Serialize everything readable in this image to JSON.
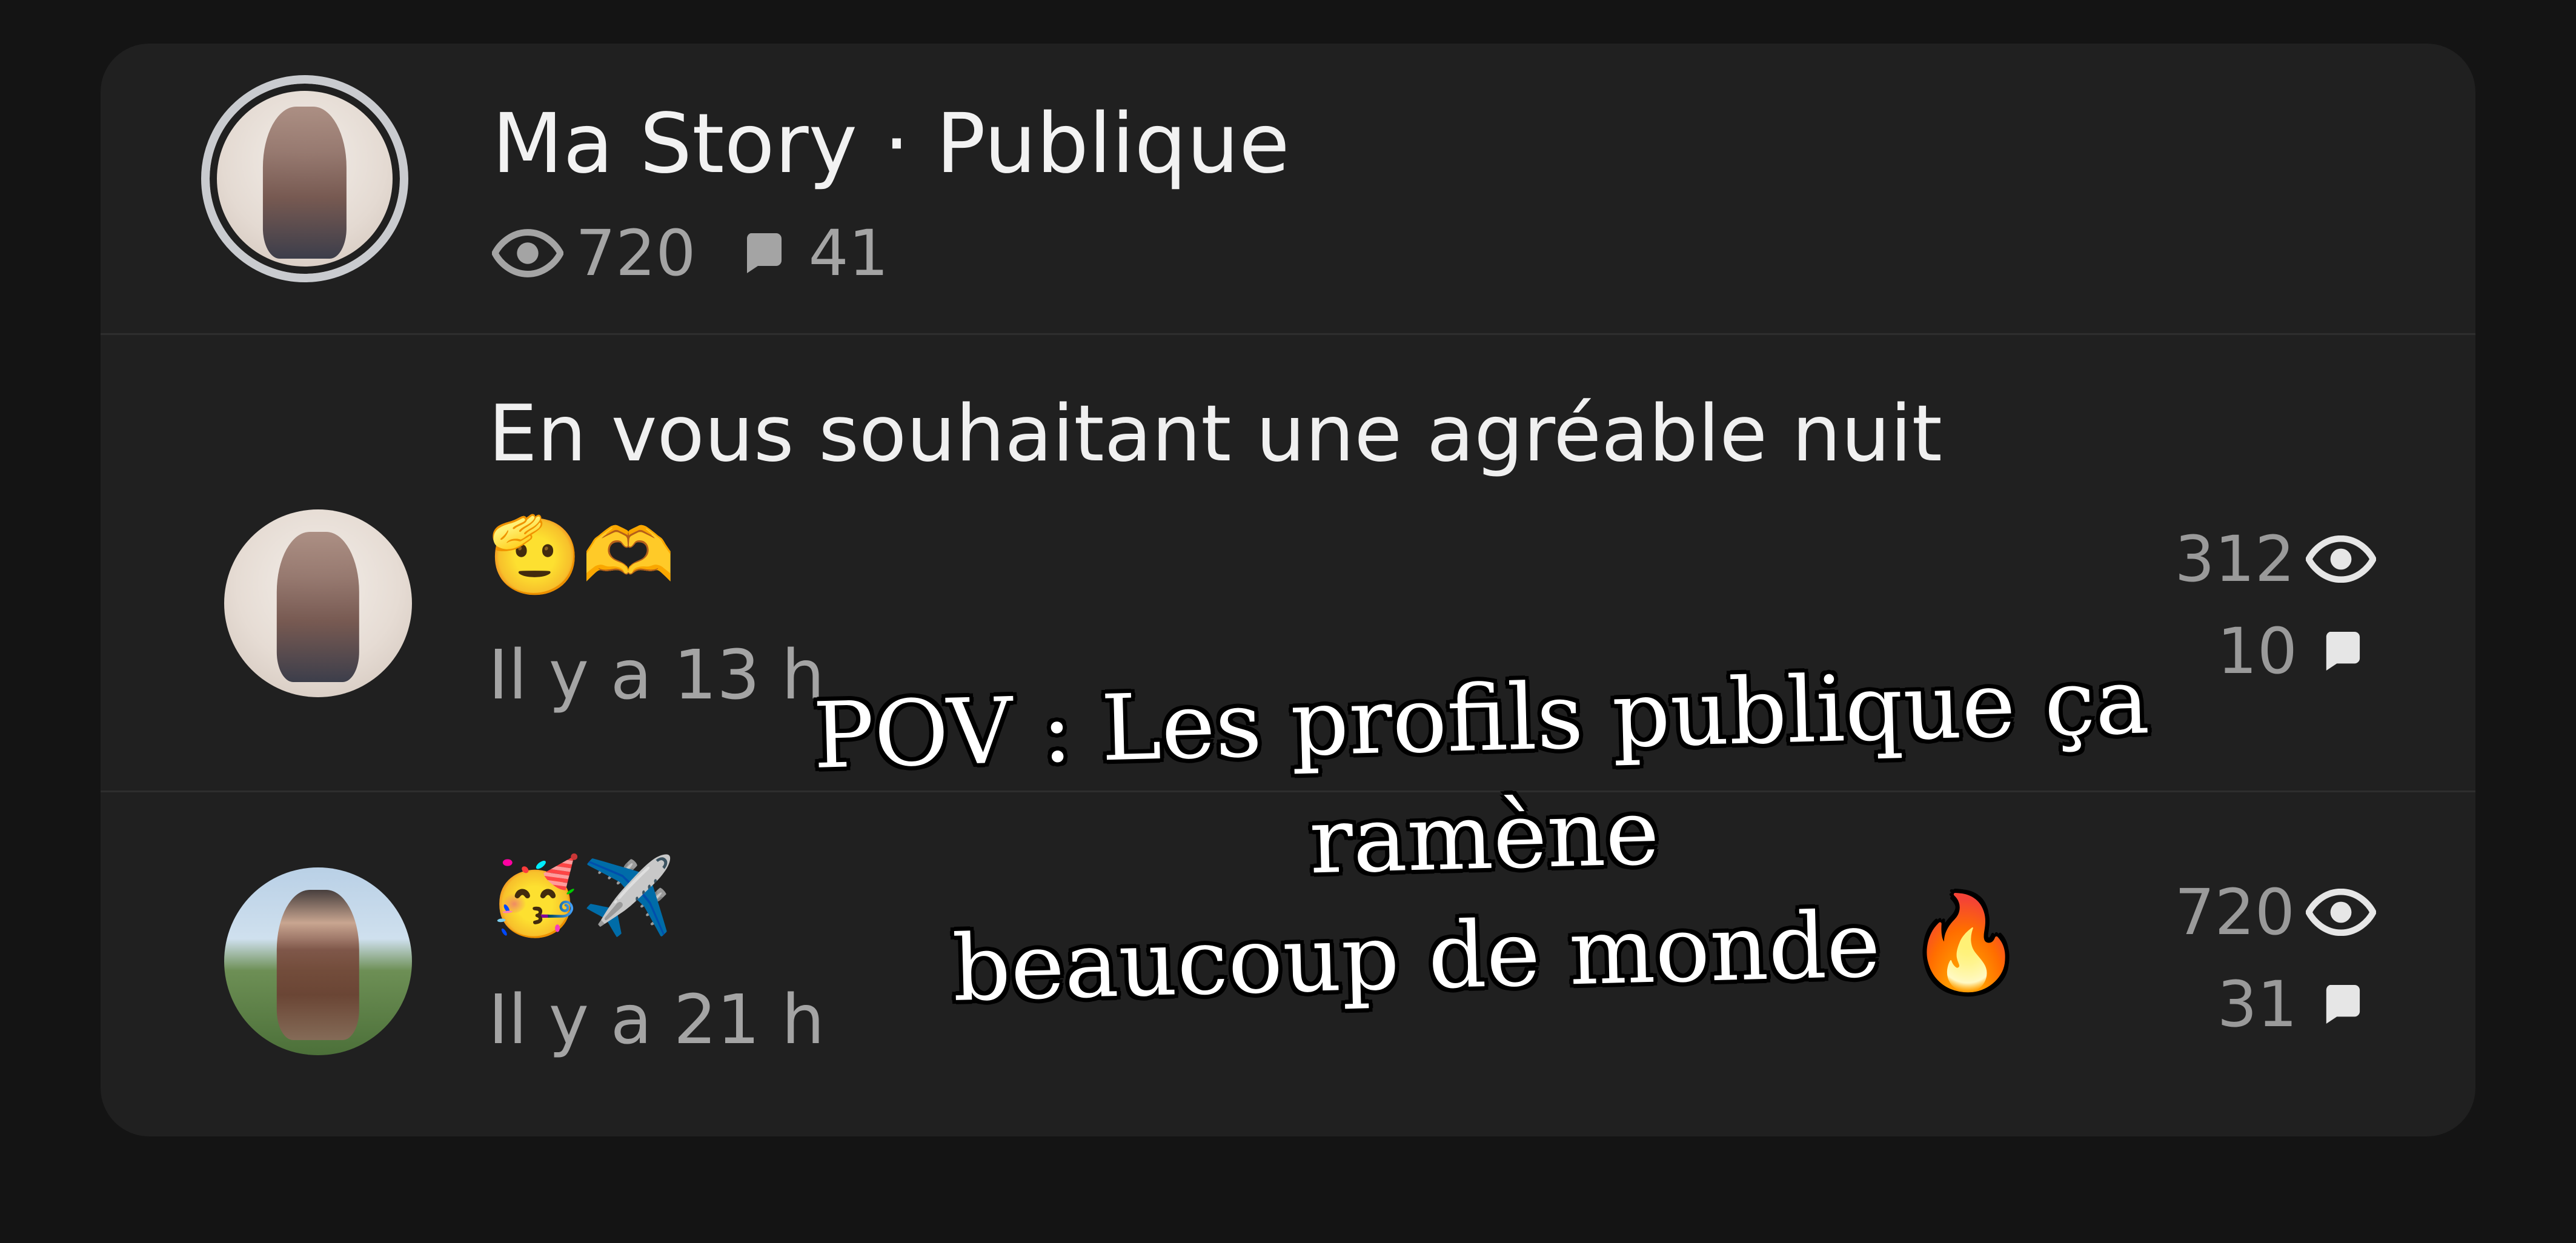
{
  "story_header": {
    "title": "Ma Story · Publique",
    "views": "720",
    "comments": "41",
    "views_icon": "eye-icon",
    "comments_icon": "comment-bubble-icon"
  },
  "posts": [
    {
      "message": "En vous souhaitant une agréable nuit",
      "emojis": "🫡🫶",
      "time": "Il y a 13 h",
      "views": "312",
      "comments": "10"
    },
    {
      "message": "",
      "emojis": "🥳✈️",
      "time": "Il y a 21 h",
      "views": "720",
      "comments": "31"
    }
  ],
  "overlay_caption": {
    "line1": "POV : Les profils publique ça ramène",
    "line2": "beaucoup de monde 🔥"
  },
  "colors": {
    "background": "#141414",
    "card": "#202020",
    "primary_text": "#f2f2f2",
    "secondary_text": "#a4a4a4"
  }
}
